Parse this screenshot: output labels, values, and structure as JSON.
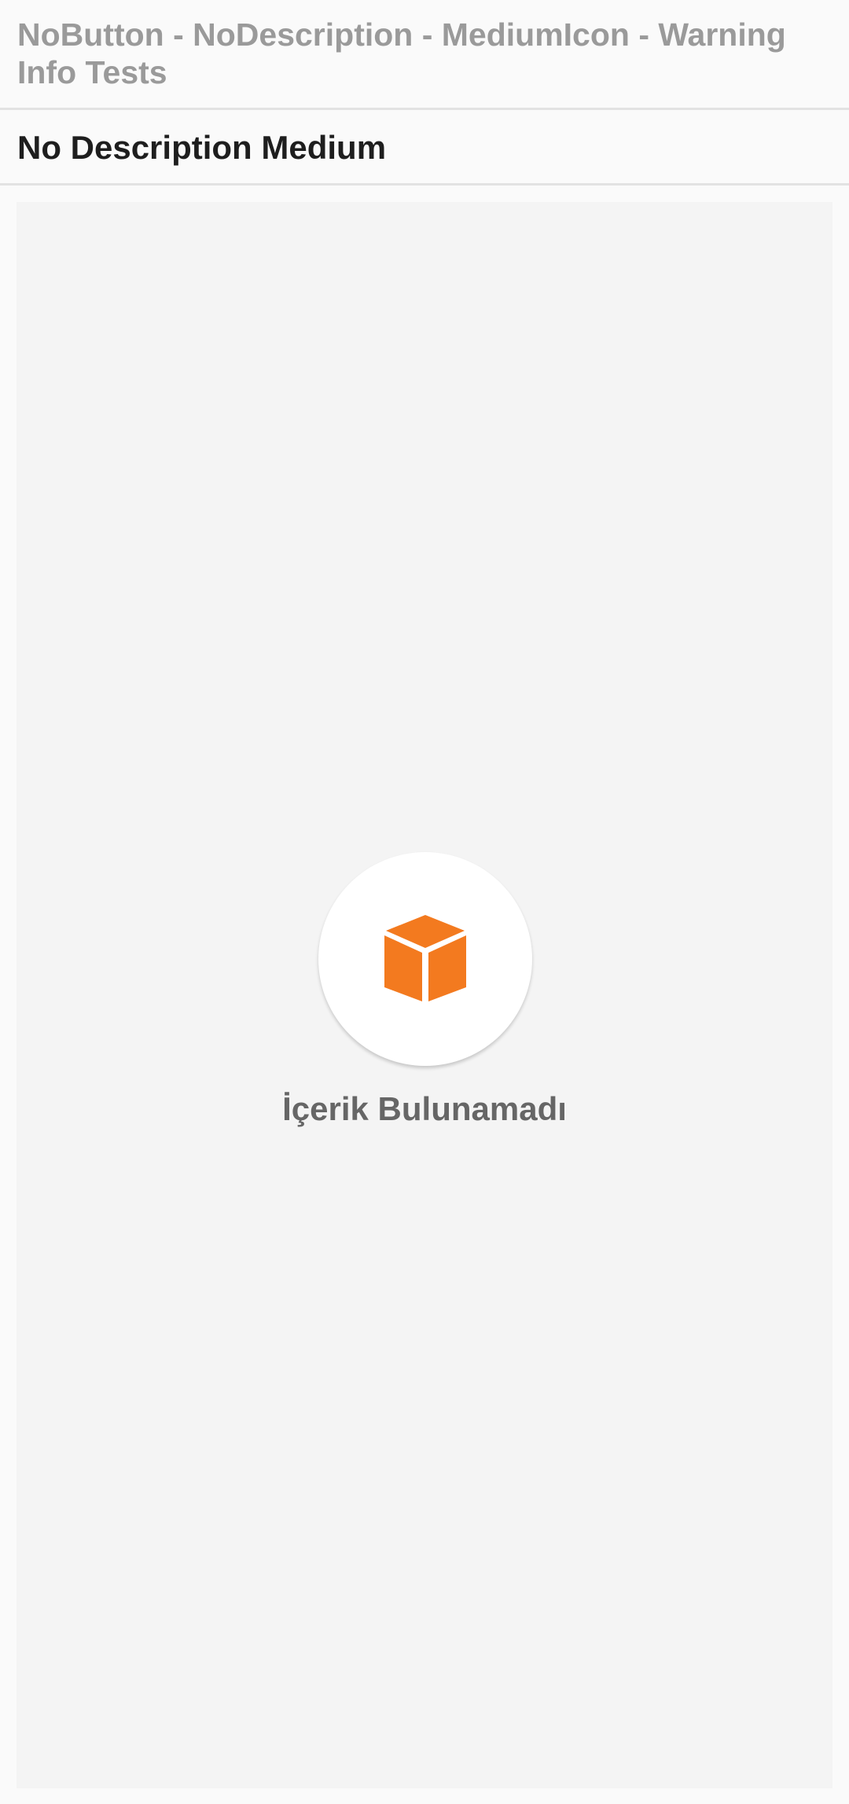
{
  "header": {
    "title": "NoButton - NoDescription - MediumIcon - Warning Info Tests"
  },
  "subheader": {
    "title": "No Description Medium"
  },
  "empty_state": {
    "icon": "box-icon",
    "icon_color": "#f37a1f",
    "message": "İçerik Bulunamadı"
  }
}
